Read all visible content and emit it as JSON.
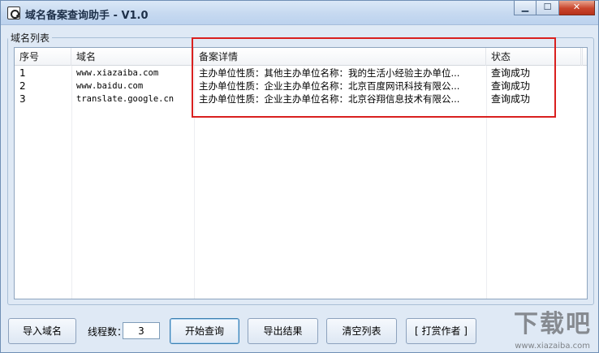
{
  "window": {
    "title": "域名备案查询助手 - V1.0",
    "controls": {
      "minimize": "▁",
      "maximize": "☐",
      "close": "✕"
    }
  },
  "group": {
    "legend": "域名列表"
  },
  "list": {
    "columns": [
      "序号",
      "域名",
      "备案详情",
      "状态"
    ],
    "rows": [
      {
        "index": "1",
        "domain": "www.xiazaiba.com",
        "detail": "主办单位性质：其他主办单位名称：我的生活小经验主办单位...",
        "status": "查询成功"
      },
      {
        "index": "2",
        "domain": "www.baidu.com",
        "detail": "主办单位性质：企业主办单位名称：北京百度网讯科技有限公...",
        "status": "查询成功"
      },
      {
        "index": "3",
        "domain": "translate.google.cn",
        "detail": "主办单位性质：企业主办单位名称：北京谷翔信息技术有限公...",
        "status": "查询成功"
      }
    ]
  },
  "toolbar": {
    "import_label": "导入域名",
    "thread_label": "线程数：",
    "thread_value": "3",
    "start_label": "开始查询",
    "export_label": "导出结果",
    "clear_label": "清空列表",
    "donate_label": "[ 打赏作者 ]"
  },
  "watermark": {
    "corner": "下载吧",
    "corner_sub": "www.xiazaiba.com"
  },
  "colors": {
    "highlight": "#d9201f",
    "background": "#dfe9f5"
  }
}
